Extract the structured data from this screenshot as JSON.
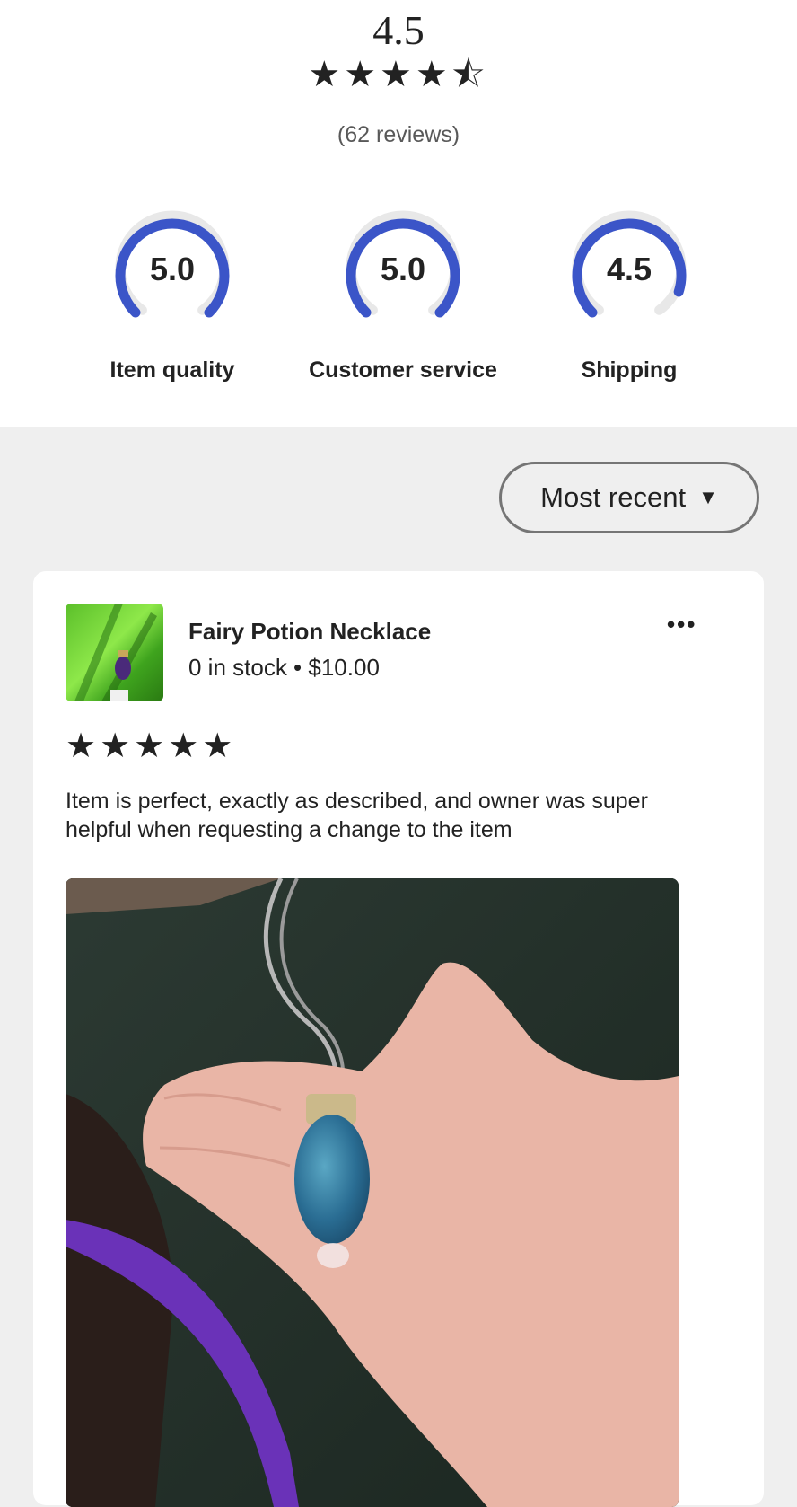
{
  "summary": {
    "average": "4.5",
    "stars": "★★★★⯪",
    "reviews_count": "(62 reviews)"
  },
  "gauges": [
    {
      "value": "5.0",
      "label": "Item quality",
      "fraction": 1.0
    },
    {
      "value": "5.0",
      "label": "Customer service",
      "fraction": 1.0
    },
    {
      "value": "4.5",
      "label": "Shipping",
      "fraction": 0.9
    }
  ],
  "sort": {
    "label": "Most recent"
  },
  "review": {
    "product_title": "Fairy Potion Necklace",
    "product_subtitle": "0 in stock • $10.00",
    "more_label": "•••",
    "stars": "★★★★★",
    "rating": 5,
    "text": "Item is perfect, exactly as described, and owner was super helpful when requesting a change to the item"
  },
  "colors": {
    "gauge": "#3b55c8",
    "gauge_track": "#e8e8e8",
    "background": "#efefef"
  }
}
